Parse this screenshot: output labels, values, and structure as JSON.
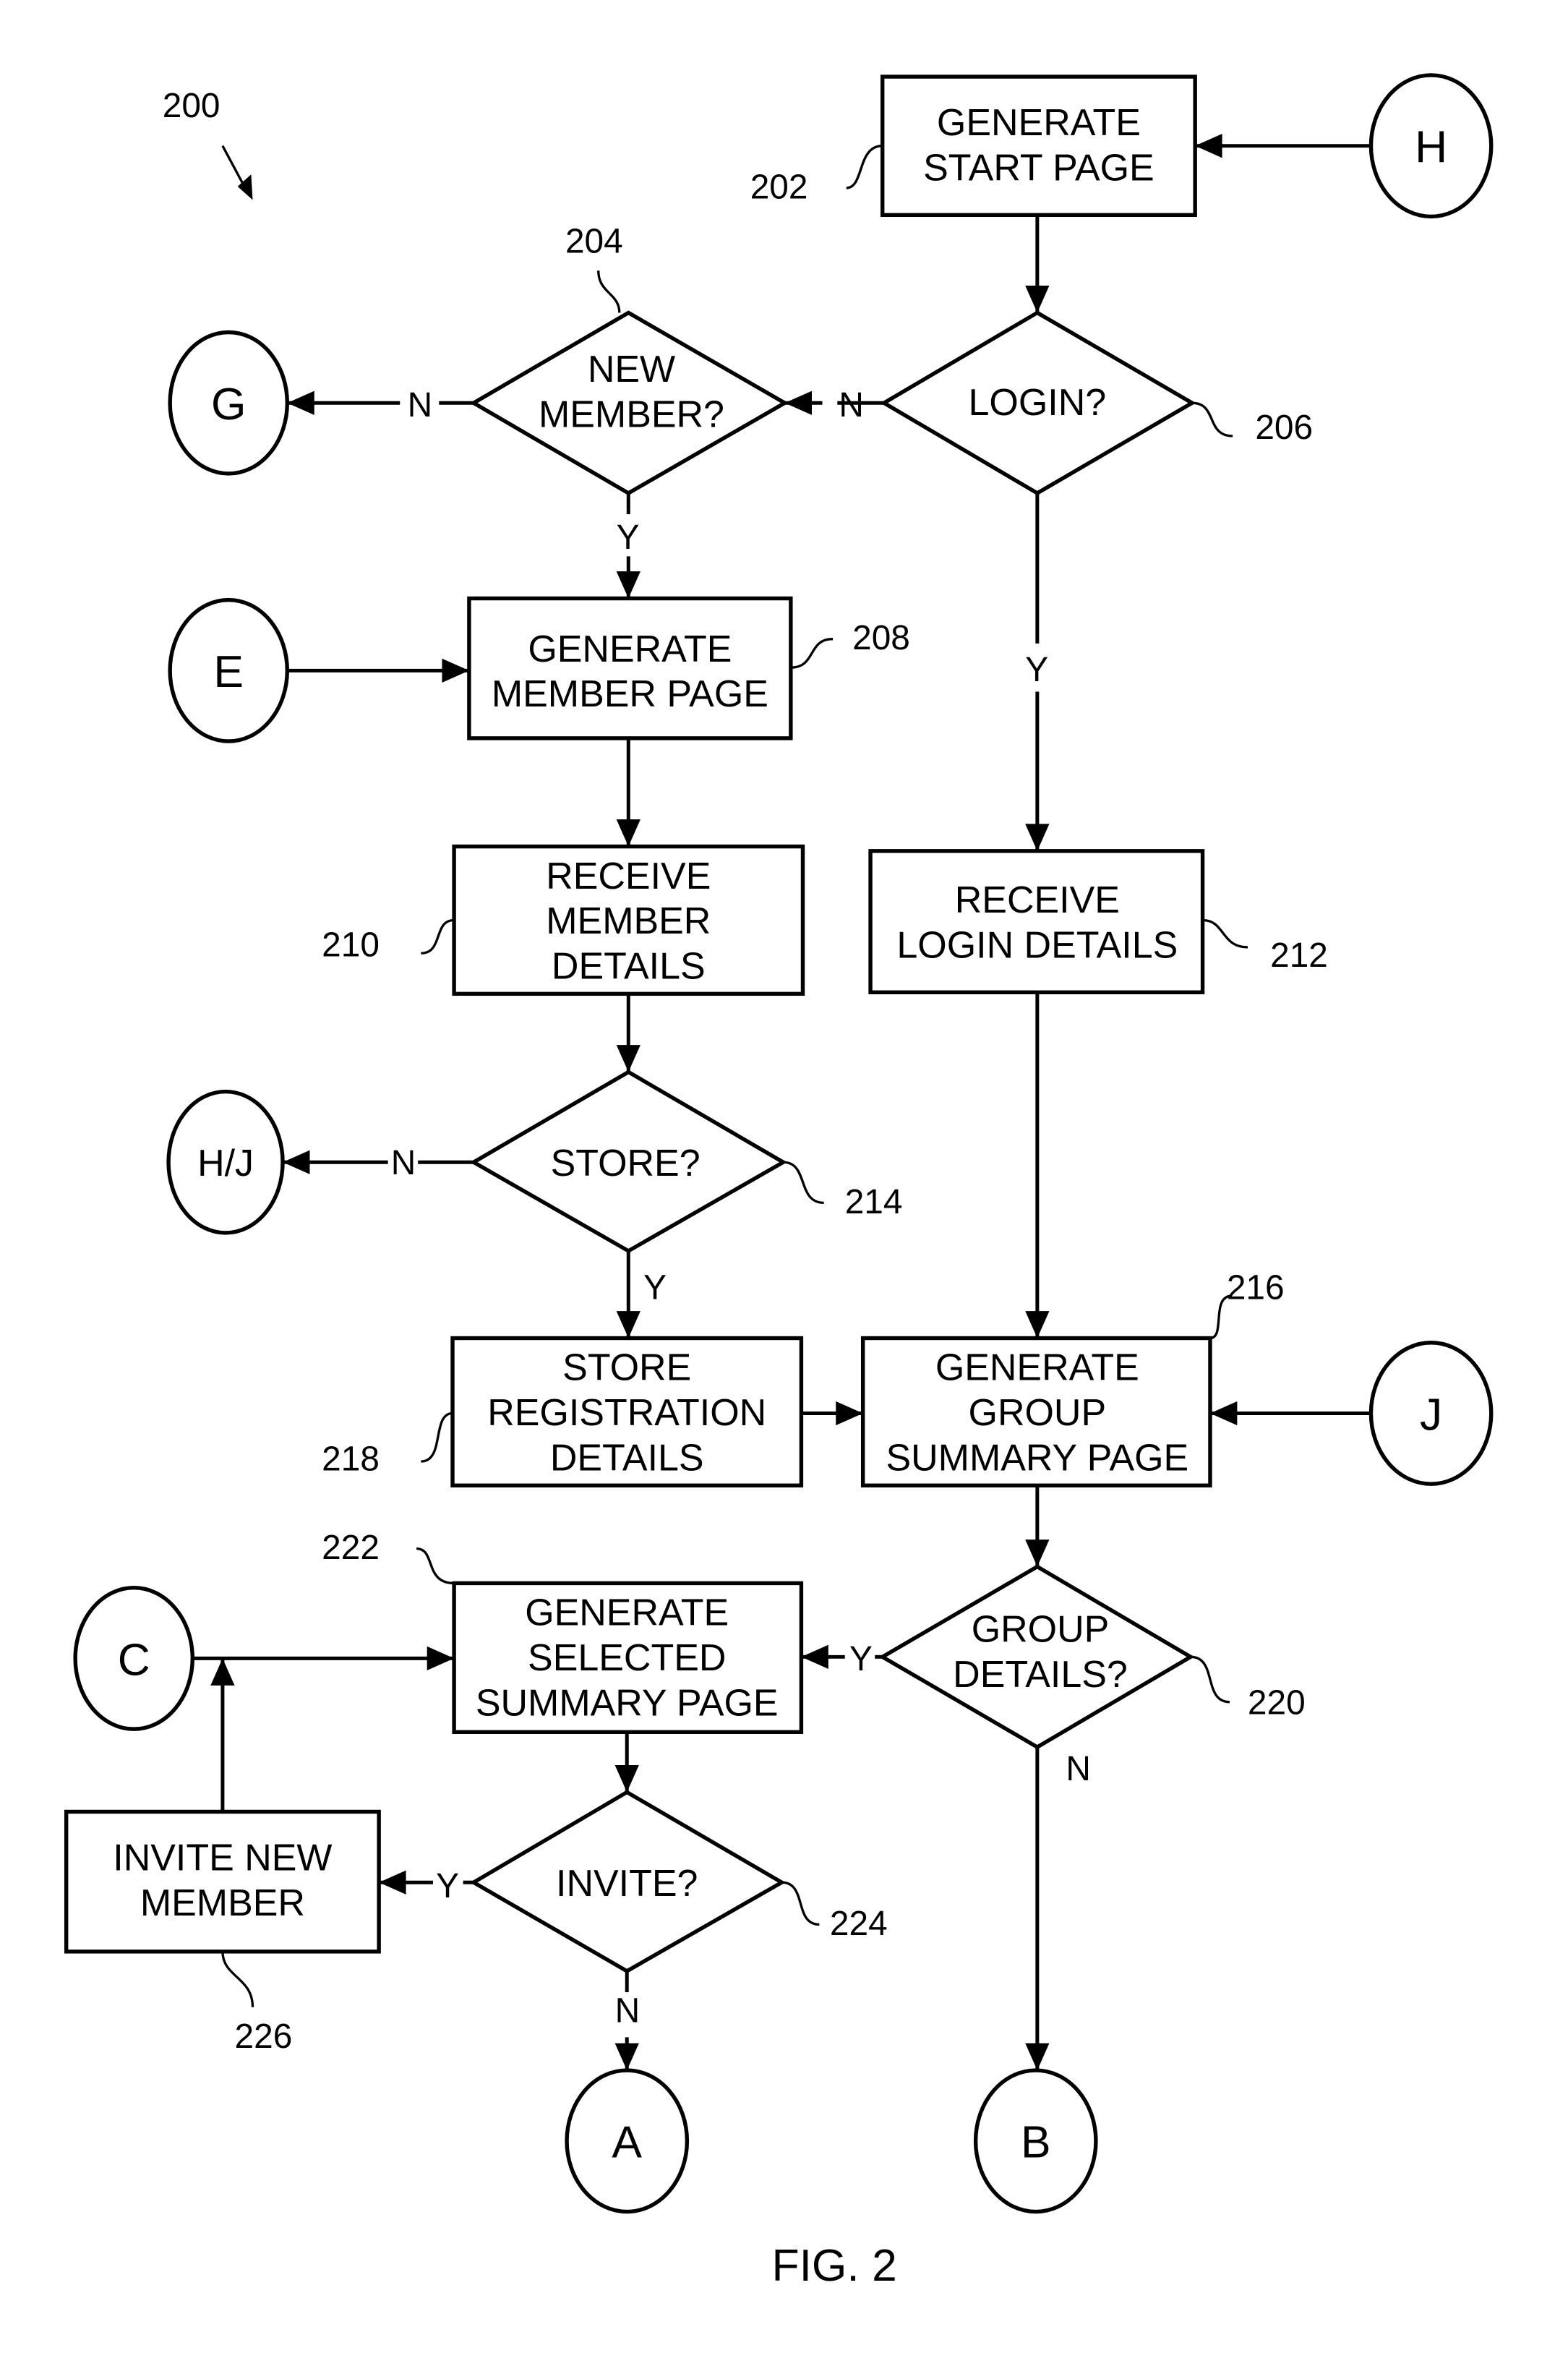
{
  "figure": {
    "label": "FIG. 2",
    "ref": "200"
  },
  "nodes": {
    "n202": {
      "ref": "202",
      "type": "process",
      "lines": [
        "GENERATE",
        "START PAGE"
      ]
    },
    "n204": {
      "ref": "204",
      "type": "decision",
      "lines": [
        "NEW",
        "MEMBER?"
      ]
    },
    "n206": {
      "ref": "206",
      "type": "decision",
      "lines": [
        "LOGIN?"
      ]
    },
    "n208": {
      "ref": "208",
      "type": "process",
      "lines": [
        "GENERATE",
        "MEMBER PAGE"
      ]
    },
    "n210": {
      "ref": "210",
      "type": "process",
      "lines": [
        "RECEIVE",
        "MEMBER",
        "DETAILS"
      ]
    },
    "n212": {
      "ref": "212",
      "type": "process",
      "lines": [
        "RECEIVE",
        "LOGIN DETAILS"
      ]
    },
    "n214": {
      "ref": "214",
      "type": "decision",
      "lines": [
        "STORE?"
      ]
    },
    "n216": {
      "ref": "216",
      "type": "process",
      "lines": [
        "GENERATE",
        "GROUP",
        "SUMMARY PAGE"
      ]
    },
    "n218": {
      "ref": "218",
      "type": "process",
      "lines": [
        "STORE",
        "REGISTRATION",
        "DETAILS"
      ]
    },
    "n220": {
      "ref": "220",
      "type": "decision",
      "lines": [
        "GROUP",
        "DETAILS?"
      ]
    },
    "n222": {
      "ref": "222",
      "type": "process",
      "lines": [
        "GENERATE",
        "SELECTED",
        "SUMMARY PAGE"
      ]
    },
    "n224": {
      "ref": "224",
      "type": "decision",
      "lines": [
        "INVITE?"
      ]
    },
    "n226": {
      "ref": "226",
      "type": "process",
      "lines": [
        "INVITE NEW",
        "MEMBER"
      ]
    }
  },
  "connectors": {
    "H": "H",
    "G": "G",
    "E": "E",
    "HJ": "H/J",
    "J": "J",
    "C": "C",
    "A": "A",
    "B": "B"
  },
  "edge_labels": {
    "e206_n": "N",
    "e204_n": "N",
    "e204_y": "Y",
    "e206_y": "Y",
    "e214_n": "N",
    "e214_y": "Y",
    "e220_y": "Y",
    "e220_n": "N",
    "e224_y": "Y",
    "e224_n": "N"
  },
  "edges": [
    {
      "from": "H",
      "to": "n202"
    },
    {
      "from": "n202",
      "to": "n206"
    },
    {
      "from": "n206",
      "to": "n204",
      "label": "N"
    },
    {
      "from": "n204",
      "to": "G",
      "label": "N"
    },
    {
      "from": "n204",
      "to": "n208",
      "label": "Y"
    },
    {
      "from": "E",
      "to": "n208"
    },
    {
      "from": "n206",
      "to": "n212",
      "label": "Y"
    },
    {
      "from": "n208",
      "to": "n210"
    },
    {
      "from": "n210",
      "to": "n214"
    },
    {
      "from": "n214",
      "to": "H/J",
      "label": "N"
    },
    {
      "from": "n214",
      "to": "n218",
      "label": "Y"
    },
    {
      "from": "n212",
      "to": "n216"
    },
    {
      "from": "n218",
      "to": "n216"
    },
    {
      "from": "J",
      "to": "n216"
    },
    {
      "from": "n216",
      "to": "n220"
    },
    {
      "from": "n220",
      "to": "n222",
      "label": "Y"
    },
    {
      "from": "n220",
      "to": "B",
      "label": "N"
    },
    {
      "from": "C",
      "to": "n222"
    },
    {
      "from": "n222",
      "to": "n224"
    },
    {
      "from": "n224",
      "to": "n226",
      "label": "Y"
    },
    {
      "from": "n224",
      "to": "A",
      "label": "N"
    },
    {
      "from": "n226",
      "to": "C-line"
    }
  ]
}
